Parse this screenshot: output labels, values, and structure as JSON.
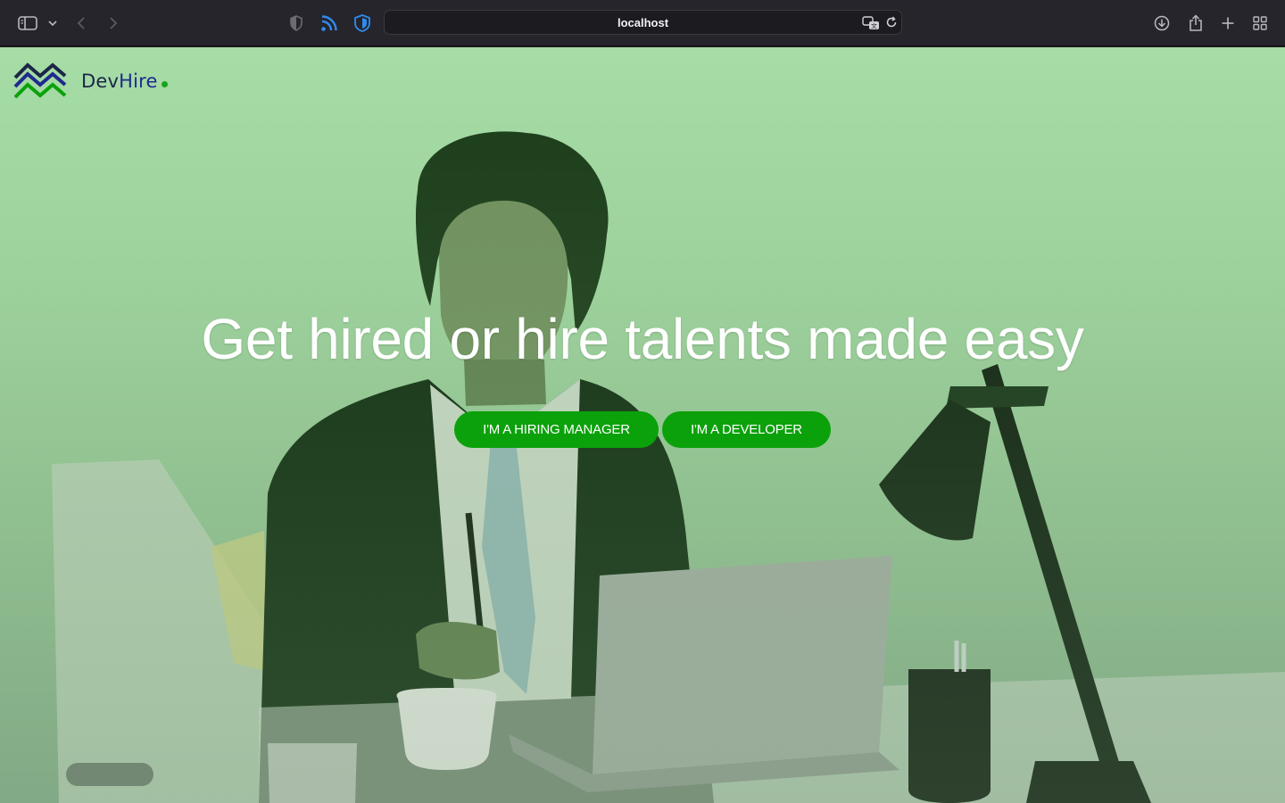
{
  "browser": {
    "url": "localhost",
    "icons": [
      "sidebar-icon",
      "chevron-down-icon",
      "back-icon",
      "forward-icon",
      "shield-icon",
      "rss-icon",
      "password-icon",
      "translate-icon",
      "reload-icon",
      "download-icon",
      "share-icon",
      "new-tab-icon",
      "tab-overview-icon"
    ]
  },
  "site": {
    "logo": {
      "part1": "Dev",
      "part2": "Hire"
    },
    "headline": "Get hired or hire talents made easy",
    "buttons": {
      "hiring_manager": "I'M A HIRING MANAGER",
      "developer": "I'M A DEVELOPER"
    }
  },
  "colors": {
    "accent": "#0ba10b",
    "logo_dark": "#1b2746",
    "logo_blue": "#1f2a8c",
    "overlay_top": "#a6dca6",
    "overlay_bottom": "#7ea582"
  }
}
